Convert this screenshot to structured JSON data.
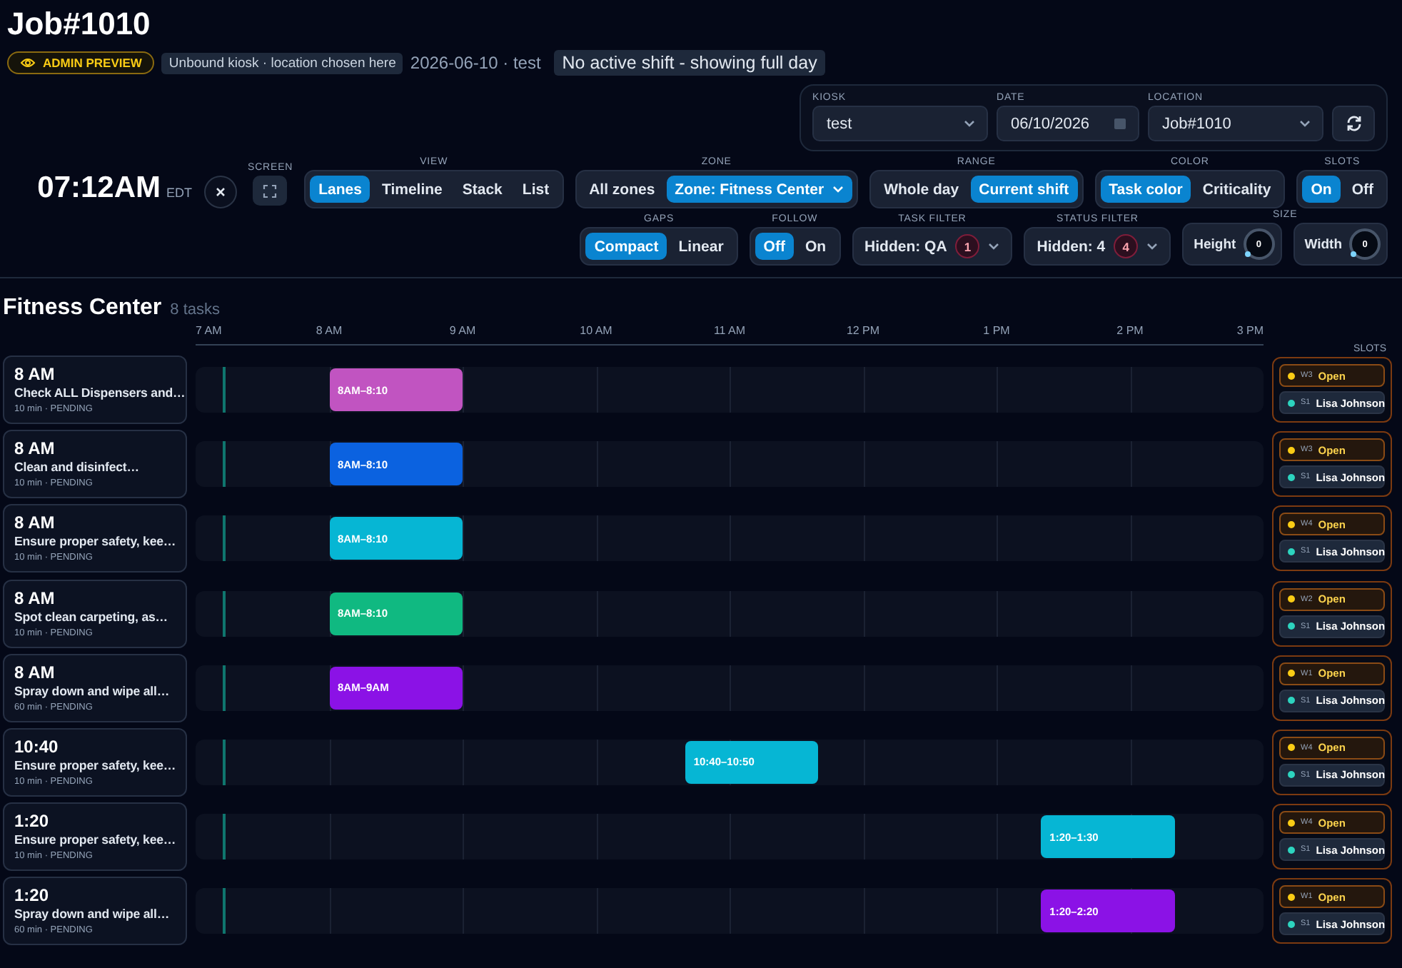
{
  "header": {
    "title": "Job#1010",
    "badges": [
      {
        "kind": "admin",
        "text": "ADMIN PREVIEW"
      },
      {
        "kind": "info",
        "text": "Unbound kiosk · location chosen here"
      },
      {
        "kind": "plain",
        "text": "2026-06-10 · test"
      },
      {
        "kind": "notice",
        "text": "No active shift - showing full day"
      }
    ]
  },
  "config": {
    "fields": [
      {
        "kind": "select",
        "label": "KIOSK",
        "value": "test"
      },
      {
        "kind": "date",
        "label": "DATE",
        "value": "06/10/2026"
      },
      {
        "kind": "select",
        "label": "LOCATION",
        "value": "Job#1010"
      }
    ]
  },
  "control_rows": [
    [
      {
        "kind": "clock",
        "time": "07:12AM",
        "zone": "EDT"
      },
      {
        "kind": "close"
      },
      {
        "kind": "icon_button",
        "label": "SCREEN"
      },
      {
        "kind": "segmented",
        "label": "VIEW",
        "options": [
          {
            "label": "Lanes",
            "selected": true
          },
          {
            "label": "Timeline",
            "selected": false
          },
          {
            "label": "Stack",
            "selected": false
          },
          {
            "label": "List",
            "selected": false
          }
        ]
      },
      {
        "kind": "segmented",
        "label": "ZONE",
        "options": [
          {
            "label": "All zones",
            "selected": false
          },
          {
            "label": "Zone: Fitness Center",
            "selected": true,
            "caret": true
          }
        ]
      },
      {
        "kind": "segmented",
        "label": "RANGE",
        "options": [
          {
            "label": "Whole day",
            "selected": false
          },
          {
            "label": "Current shift",
            "selected": true
          }
        ]
      },
      {
        "kind": "segmented",
        "label": "COLOR",
        "options": [
          {
            "label": "Task color",
            "selected": true
          },
          {
            "label": "Criticality",
            "selected": false
          }
        ]
      },
      {
        "kind": "segmented",
        "label": "SLOTS",
        "options": [
          {
            "label": "On",
            "selected": true
          },
          {
            "label": "Off",
            "selected": false
          }
        ]
      }
    ],
    [
      {
        "kind": "segmented",
        "label": "GAPS",
        "options": [
          {
            "label": "Compact",
            "selected": true
          },
          {
            "label": "Linear",
            "selected": false
          }
        ]
      },
      {
        "kind": "segmented",
        "label": "FOLLOW",
        "options": [
          {
            "label": "Off",
            "selected": true
          },
          {
            "label": "On",
            "selected": false
          }
        ]
      },
      {
        "kind": "filter",
        "label": "TASK FILTER",
        "value": "Hidden: QA",
        "count": "1"
      },
      {
        "kind": "filter",
        "label": "STATUS FILTER",
        "value": "Hidden: 4",
        "count": "4"
      },
      {
        "kind": "knobs",
        "label": "SIZE",
        "knobs": [
          {
            "label": "Height",
            "value": "0"
          },
          {
            "label": "Width",
            "value": "0"
          }
        ]
      }
    ]
  ],
  "timeline": {
    "title": "Fitness Center",
    "count": "8 tasks",
    "axis": [
      "7 AM",
      "8 AM",
      "9 AM",
      "10 AM",
      "11 AM",
      "12 PM",
      "1 PM",
      "2 PM",
      "3 PM"
    ],
    "slots_label": "SLOTS",
    "tasks": [
      {
        "time": "8 AM",
        "title": "Check ALL Dispensers and…",
        "meta": "10 min · PENDING",
        "bar": {
          "label": "8AM–8:10",
          "color": "#c154c1"
        },
        "slots": [
          {
            "kind": "open",
            "code": "W3",
            "name": "Open",
            "color": "#facc15"
          },
          {
            "kind": "assigned",
            "code": "S1",
            "name": "Lisa Johnson",
            "color": "#2dd4bf"
          }
        ]
      },
      {
        "time": "8 AM",
        "title": "Clean and disinfect…",
        "meta": "10 min · PENDING",
        "bar": {
          "label": "8AM–8:10",
          "color": "#0b62e0"
        },
        "slots": [
          {
            "kind": "open",
            "code": "W3",
            "name": "Open",
            "color": "#facc15"
          },
          {
            "kind": "assigned",
            "code": "S1",
            "name": "Lisa Johnson",
            "color": "#2dd4bf"
          }
        ]
      },
      {
        "time": "8 AM",
        "title": "Ensure proper safety, kee…",
        "meta": "10 min · PENDING",
        "bar": {
          "label": "8AM–8:10",
          "color": "#06b6d4"
        },
        "slots": [
          {
            "kind": "open",
            "code": "W4",
            "name": "Open",
            "color": "#facc15"
          },
          {
            "kind": "assigned",
            "code": "S1",
            "name": "Lisa Johnson",
            "color": "#2dd4bf"
          }
        ]
      },
      {
        "time": "8 AM",
        "title": "Spot clean carpeting, as…",
        "meta": "10 min · PENDING",
        "bar": {
          "label": "8AM–8:10",
          "color": "#10b981"
        },
        "slots": [
          {
            "kind": "open",
            "code": "W2",
            "name": "Open",
            "color": "#facc15"
          },
          {
            "kind": "assigned",
            "code": "S1",
            "name": "Lisa Johnson",
            "color": "#2dd4bf"
          }
        ]
      },
      {
        "time": "8 AM",
        "title": "Spray down and wipe all…",
        "meta": "60 min · PENDING",
        "bar": {
          "label": "8AM–9AM",
          "color": "#8b12e6"
        },
        "slots": [
          {
            "kind": "open",
            "code": "W1",
            "name": "Open",
            "color": "#facc15"
          },
          {
            "kind": "assigned",
            "code": "S1",
            "name": "Lisa Johnson",
            "color": "#2dd4bf"
          }
        ]
      },
      {
        "time": "10:40",
        "title": "Ensure proper safety, kee…",
        "meta": "10 min · PENDING",
        "bar": {
          "label": "10:40–10:50",
          "color": "#06b6d4"
        },
        "slots": [
          {
            "kind": "open",
            "code": "W4",
            "name": "Open",
            "color": "#facc15"
          },
          {
            "kind": "assigned",
            "code": "S1",
            "name": "Lisa Johnson",
            "color": "#2dd4bf"
          }
        ]
      },
      {
        "time": "1:20",
        "title": "Ensure proper safety, kee…",
        "meta": "10 min · PENDING",
        "bar": {
          "label": "1:20–1:30",
          "color": "#06b6d4"
        },
        "slots": [
          {
            "kind": "open",
            "code": "W4",
            "name": "Open",
            "color": "#facc15"
          },
          {
            "kind": "assigned",
            "code": "S1",
            "name": "Lisa Johnson",
            "color": "#2dd4bf"
          }
        ]
      },
      {
        "time": "1:20",
        "title": "Spray down and wipe all…",
        "meta": "60 min · PENDING",
        "bar": {
          "label": "1:20–2:20",
          "color": "#8b12e6"
        },
        "slots": [
          {
            "kind": "open",
            "code": "W1",
            "name": "Open",
            "color": "#facc15"
          },
          {
            "kind": "assigned",
            "code": "S1",
            "name": "Lisa Johnson",
            "color": "#2dd4bf"
          }
        ]
      }
    ]
  }
}
